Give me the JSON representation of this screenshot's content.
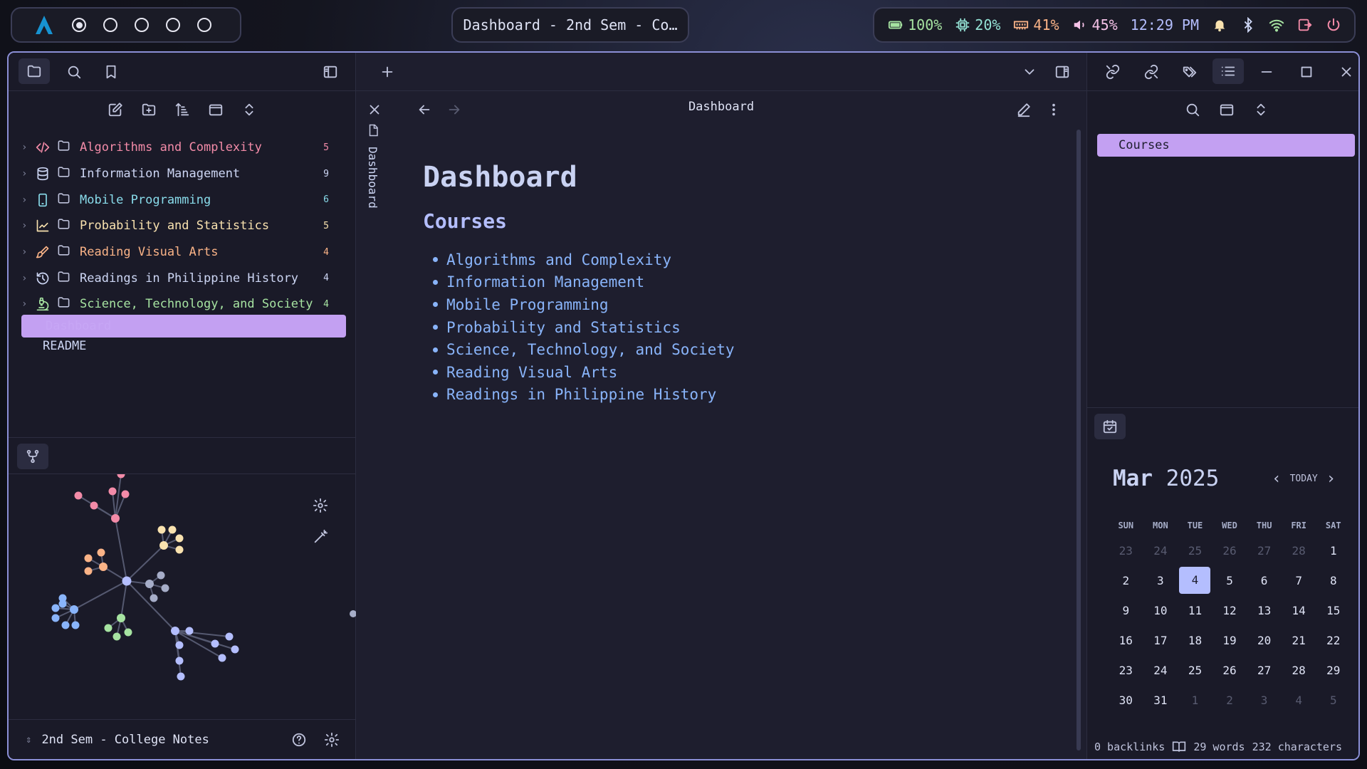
{
  "topbar": {
    "workspaces": [
      {
        "active": true
      },
      {
        "active": false
      },
      {
        "active": false
      },
      {
        "active": false
      },
      {
        "active": false
      }
    ],
    "window_title": "Dashboard - 2nd Sem - Co…",
    "battery": "100%",
    "cpu": "20%",
    "ram": "41%",
    "volume": "45%",
    "clock": "12:29 PM"
  },
  "explorer": {
    "folders": [
      {
        "label": "Algorithms and Complexity",
        "count": "5",
        "color": "#f38ba8",
        "icon": "code-icon"
      },
      {
        "label": "Information Management",
        "count": "9",
        "color": "#cdd6f4",
        "icon": "database-icon"
      },
      {
        "label": "Mobile Programming",
        "count": "6",
        "color": "#89dceb",
        "icon": "smartphone-icon"
      },
      {
        "label": "Probability and Statistics",
        "count": "5",
        "color": "#f9e2af",
        "icon": "line-chart-icon"
      },
      {
        "label": "Reading Visual Arts",
        "count": "4",
        "color": "#fab387",
        "icon": "brush-icon"
      },
      {
        "label": "Readings in Philippine History",
        "count": "4",
        "color": "#cdd6f4",
        "icon": "history-icon"
      },
      {
        "label": "Science, Technology, and Society",
        "count": "4",
        "color": "#a6e3a1",
        "icon": "microscope-icon"
      }
    ],
    "selected_file": "Dashboard",
    "readme": "README"
  },
  "vault_name": "2nd Sem - College Notes",
  "note": {
    "breadcrumb": "Dashboard",
    "vertical_tab": "Dashboard",
    "title": "Dashboard",
    "heading": "Courses",
    "links": [
      "Algorithms and Complexity",
      "Information Management",
      "Mobile Programming",
      "Probability and Statistics",
      "Science, Technology, and Society",
      "Reading Visual Arts",
      "Readings in Philippine History"
    ]
  },
  "outline": {
    "item": "Courses"
  },
  "calendar": {
    "month": "Mar",
    "year": "2025",
    "today_label": "TODAY",
    "weekdays": [
      "SUN",
      "MON",
      "TUE",
      "WED",
      "THU",
      "FRI",
      "SAT"
    ],
    "weeks": [
      [
        {
          "d": "23",
          "m": true
        },
        {
          "d": "24",
          "m": true
        },
        {
          "d": "25",
          "m": true
        },
        {
          "d": "26",
          "m": true
        },
        {
          "d": "27",
          "m": true
        },
        {
          "d": "28",
          "m": true
        },
        {
          "d": "1"
        }
      ],
      [
        {
          "d": "2"
        },
        {
          "d": "3"
        },
        {
          "d": "4",
          "t": true
        },
        {
          "d": "5"
        },
        {
          "d": "6"
        },
        {
          "d": "7"
        },
        {
          "d": "8"
        }
      ],
      [
        {
          "d": "9"
        },
        {
          "d": "10"
        },
        {
          "d": "11"
        },
        {
          "d": "12"
        },
        {
          "d": "13"
        },
        {
          "d": "14"
        },
        {
          "d": "15"
        }
      ],
      [
        {
          "d": "16"
        },
        {
          "d": "17"
        },
        {
          "d": "18"
        },
        {
          "d": "19"
        },
        {
          "d": "20"
        },
        {
          "d": "21"
        },
        {
          "d": "22"
        }
      ],
      [
        {
          "d": "23"
        },
        {
          "d": "24"
        },
        {
          "d": "25"
        },
        {
          "d": "26"
        },
        {
          "d": "27"
        },
        {
          "d": "28"
        },
        {
          "d": "29"
        }
      ],
      [
        {
          "d": "30"
        },
        {
          "d": "31"
        },
        {
          "d": "1",
          "m": true
        },
        {
          "d": "2",
          "m": true
        },
        {
          "d": "3",
          "m": true
        },
        {
          "d": "4",
          "m": true
        },
        {
          "d": "5",
          "m": true
        }
      ]
    ]
  },
  "statusbar": {
    "backlinks": "0 backlinks",
    "words": "29 words",
    "characters": "232 characters"
  }
}
